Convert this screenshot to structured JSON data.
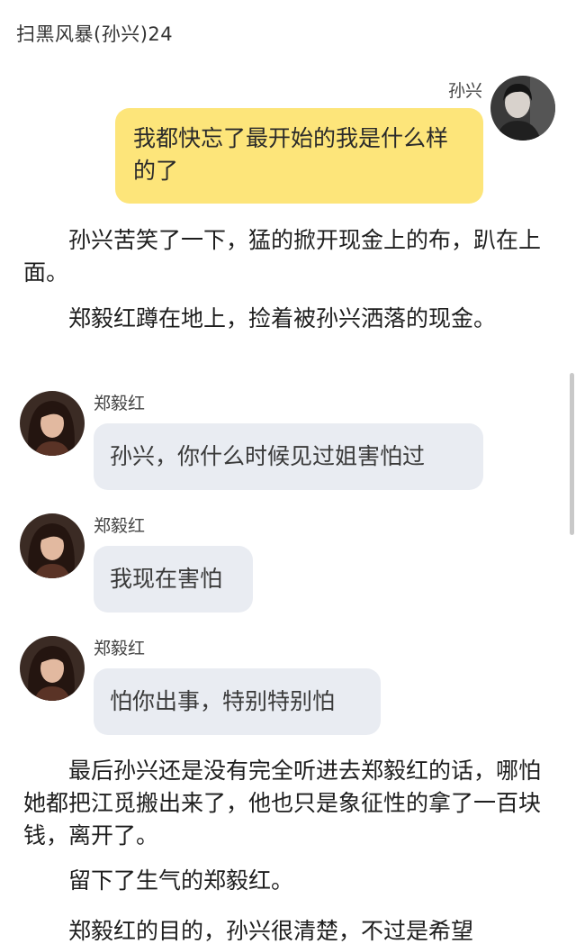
{
  "header": {
    "title": "扫黑风暴(孙兴)24"
  },
  "messages": [
    {
      "side": "right",
      "sender": "孙兴",
      "text": "我都快忘了最开始的我是什么样的了"
    },
    {
      "side": "left",
      "sender": "郑毅红",
      "text": "孙兴，你什么时候见过姐害怕过"
    },
    {
      "side": "left",
      "sender": "郑毅红",
      "text": "我现在害怕"
    },
    {
      "side": "left",
      "sender": "郑毅红",
      "text": "怕你出事，特别特别怕"
    }
  ],
  "narration": [
    "孙兴苦笑了一下，猛的掀开现金上的布，趴在上面。",
    "郑毅红蹲在地上，捡着被孙兴洒落的现金。",
    "最后孙兴还是没有完全听进去郑毅红的话，哪怕她都把江觅搬出来了，他也只是象征性的拿了一百块钱，离开了。",
    "留下了生气的郑毅红。",
    "郑毅红的目的，孙兴很清楚，不过是希望"
  ]
}
